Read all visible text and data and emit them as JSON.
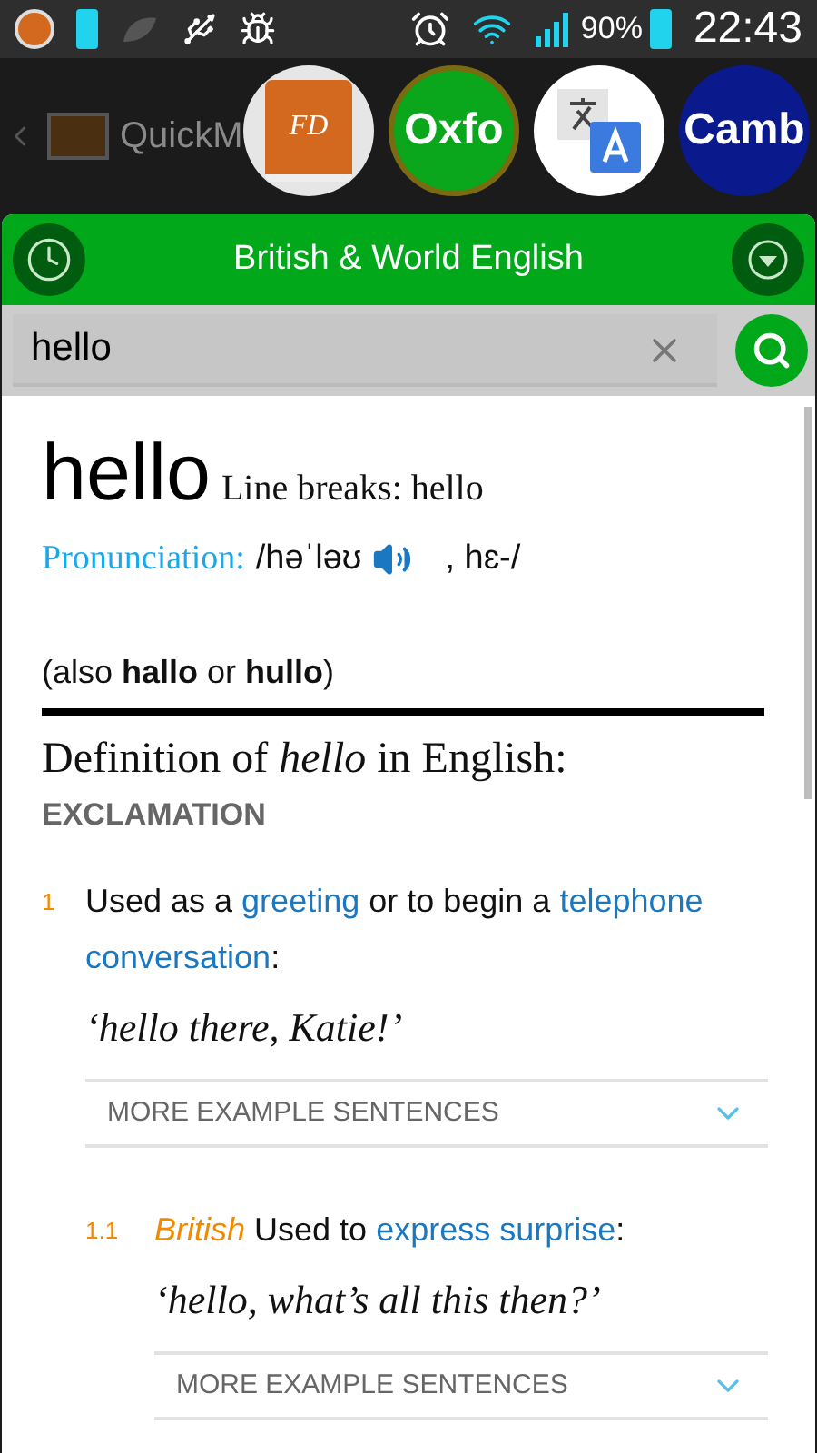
{
  "status_bar": {
    "battery_percent": "90%",
    "time": "22:43"
  },
  "background_app": {
    "title": "QuickM"
  },
  "bubbles": [
    {
      "kind": "book",
      "label": "FD",
      "selected": false
    },
    {
      "kind": "text",
      "label": "Oxfo",
      "selected": true,
      "color": "#0aa61c"
    },
    {
      "kind": "translate",
      "selected": false
    },
    {
      "kind": "text",
      "label": "Camb",
      "selected": false,
      "color": "#0a1a8c"
    }
  ],
  "header": {
    "title": "British & World English"
  },
  "search": {
    "value": "hello"
  },
  "entry": {
    "headword": "hello",
    "line_breaks": "Line breaks: hello",
    "pronunciation_label": "Pronunciation:",
    "pronunciation_main": "/həˈləʊ",
    "pronunciation_alt": ", hɛ-/",
    "variants": "(also **hallo** or **hullo**)",
    "definition_heading": "Definition of *hello* in English:",
    "part_of_speech": "EXCLAMATION"
  },
  "senses": [
    {
      "number": "1",
      "segments": [
        {
          "kind": "plain",
          "text": "Used as a "
        },
        {
          "kind": "link",
          "text": "greeting"
        },
        {
          "kind": "plain",
          "text": " or to begin a "
        },
        {
          "kind": "link",
          "text": "telephone"
        },
        {
          "kind": "link",
          "text": "conversation"
        },
        {
          "kind": "plain",
          "text": ":"
        }
      ],
      "example": "‘hello there, Katie!’",
      "more": "MORE EXAMPLE SENTENCES"
    },
    {
      "number": "1.1",
      "segments": [
        {
          "kind": "label",
          "text": "British"
        },
        {
          "kind": "plain",
          "text": " Used to "
        },
        {
          "kind": "link",
          "text": "express surprise"
        },
        {
          "kind": "plain",
          "text": ":"
        }
      ],
      "example": "‘hello, what’s all this then?’",
      "more": "MORE EXAMPLE SENTENCES"
    }
  ]
}
